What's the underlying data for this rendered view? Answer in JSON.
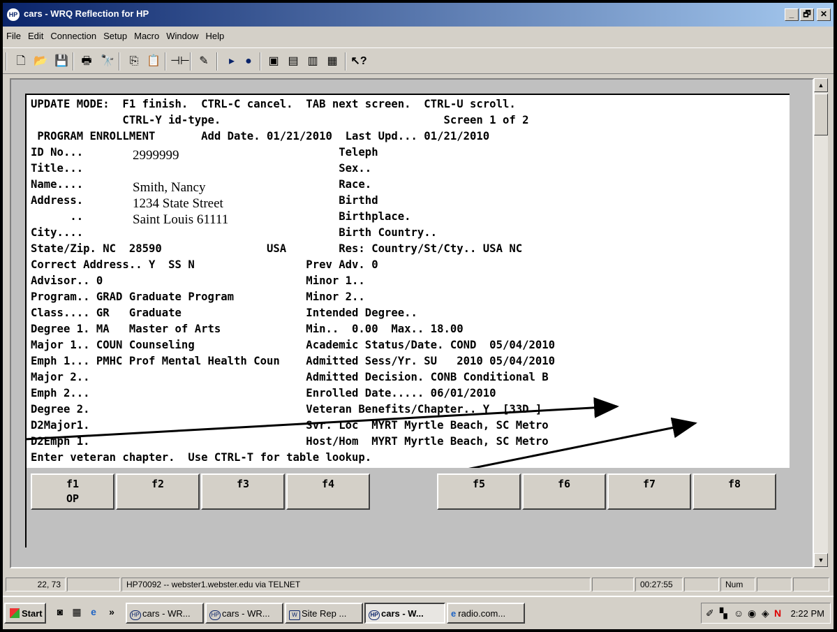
{
  "window": {
    "title": "cars - WRQ Reflection for HP",
    "app_icon": "HP"
  },
  "controls": {
    "minimize": "_",
    "maximize": "🗗",
    "close": "✕"
  },
  "menu": [
    "File",
    "Edit",
    "Connection",
    "Setup",
    "Macro",
    "Window",
    "Help"
  ],
  "toolbar_icons": [
    "new-icon",
    "open-icon",
    "save-icon",
    "print-icon",
    "find-icon",
    "copy-icon",
    "paste-icon",
    "connect-icon",
    "macro-icon",
    "play-icon",
    "record-icon",
    "screen1-icon",
    "screen2-icon",
    "screen3-icon",
    "screen4-icon",
    "help-icon"
  ],
  "terminal": {
    "lines": [
      "UPDATE MODE:  F1 finish.  CTRL-C cancel.  TAB next screen.  CTRL-U scroll.",
      "              CTRL-Y id-type.                                  Screen 1 of 2",
      " PROGRAM ENROLLMENT       Add Date. 01/21/2010  Last Upd... 01/21/2010",
      "ID No...                                       Teleph",
      "Title...                                       Sex..",
      "Name....                                       Race.",
      "Address.                                       Birthd",
      "      ..                                       Birthplace.",
      "City....                                       Birth Country..",
      "State/Zip. NC  28590                USA        Res: Country/St/Cty.. USA NC",
      "Correct Address.. Y  SS N                 Prev Adv. 0",
      "Advisor.. 0                               Minor 1..",
      "Program.. GRAD Graduate Program           Minor 2..",
      "Class.... GR   Graduate                   Intended Degree..",
      "Degree 1. MA   Master of Arts             Min..  0.00  Max.. 18.00",
      "Major 1.. COUN Counseling                 Academic Status/Date. COND  05/04/2010",
      "Emph 1... PMHC Prof Mental Health Coun    Admitted Sess/Yr. SU   2010 05/04/2010",
      "Major 2..                                 Admitted Decision. CONB Conditional B",
      "Emph 2...                                 Enrolled Date..... 06/01/2010",
      "Degree 2.                                 Veteran Benefits/Chapter.. Y  [33D ]",
      "D2Major1.                                 Svr. Loc  MYRT Myrtle Beach, SC Metro",
      "D2Emph 1.                                 Host/Hom  MYRT Myrtle Beach, SC Metro",
      "Enter veteran chapter.  Use CTRL-T for table lookup."
    ],
    "overlay": [
      "2999999",
      "Smith, Nancy",
      "1234 State Street",
      "Saint Louis 61111"
    ]
  },
  "fkeys": [
    {
      "key": "f1",
      "sub": "OP"
    },
    {
      "key": "f2",
      "sub": ""
    },
    {
      "key": "f3",
      "sub": ""
    },
    {
      "key": "f4",
      "sub": ""
    },
    {
      "key": "f5",
      "sub": ""
    },
    {
      "key": "f6",
      "sub": ""
    },
    {
      "key": "f7",
      "sub": ""
    },
    {
      "key": "f8",
      "sub": ""
    }
  ],
  "status": {
    "cursor": "22, 73",
    "connection": "HP70092 -- webster1.webster.edu via TELNET",
    "timer": "00:27:55",
    "num": "Num"
  },
  "taskbar": {
    "start": "Start",
    "chevron": "»",
    "tasks": [
      "cars - WR...",
      "cars - WR...",
      "Site Rep ...",
      "cars - W...",
      "radio.com..."
    ],
    "clock": "2:22 PM",
    "tray_letter": "N"
  }
}
